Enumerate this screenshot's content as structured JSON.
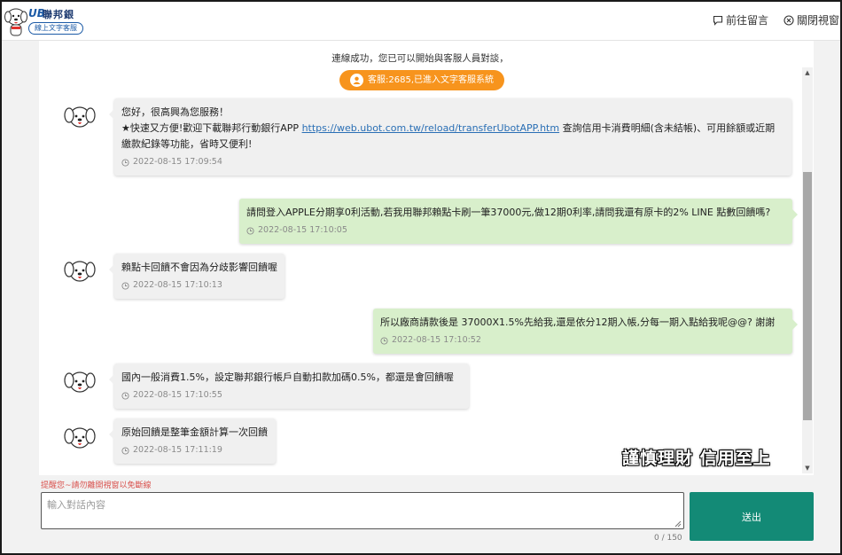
{
  "header": {
    "logo_mark": "UB",
    "bank_name": "聯邦銀行",
    "service_tag": "線上文字客服",
    "message_button": "前往留言",
    "close_button": "關閉視窗"
  },
  "chat": {
    "notice": "連線成功，您已可以開始與客服人員對談，",
    "agent_status": "客服:2685,已進入文字客服系統",
    "messages": [
      {
        "sender": "agent",
        "line1": "您好，很高興為您服務！",
        "line2_pre": "★快速又方便!歡迎下載聯邦行動銀行APP ",
        "link": "https://web.ubot.com.tw/reload/transferUbotAPP.htm",
        "line2_post": " 查詢信用卡消費明細(含未結帳)、可用餘額或近期繳款紀錄等功能，省時又便利!",
        "time": "2022-08-15 17:09:54"
      },
      {
        "sender": "user",
        "text": "請問登入APPLE分期享0利活動,若我用聯邦賴點卡刷一筆37000元,做12期0利率,請問我還有原卡的2% LINE 點數回饋嗎?",
        "time": "2022-08-15 17:10:05"
      },
      {
        "sender": "agent",
        "text": "賴點卡回饋不會因為分歧影響回饋喔",
        "time": "2022-08-15 17:10:13"
      },
      {
        "sender": "user",
        "text": "所以廠商請款後是 37000X1.5%先給我,還是依分12期入帳,分每一期入點給我呢@@? 謝謝",
        "time": "2022-08-15 17:10:52"
      },
      {
        "sender": "agent",
        "text": "國內一般消費1.5%，設定聯邦銀行帳戶自動扣款加碼0.5%，都還是會回饋喔",
        "time": "2022-08-15 17:10:55"
      },
      {
        "sender": "agent",
        "text": "原始回饋是整筆金額計算一次回饋",
        "time": "2022-08-15 17:11:19"
      }
    ]
  },
  "watermark": "謹慎理財 信用至上",
  "composer": {
    "reminder": "提醒您~請勿離開視窗以免斷線",
    "placeholder": "輸入對話內容",
    "counter": "0 / 150",
    "send_label": "送出"
  },
  "colors": {
    "accent_orange": "#f7941d",
    "send_green": "#138a76",
    "user_bubble": "#d8efcb",
    "agent_bubble": "#f0f0f0",
    "reminder_red": "#d9534f"
  }
}
